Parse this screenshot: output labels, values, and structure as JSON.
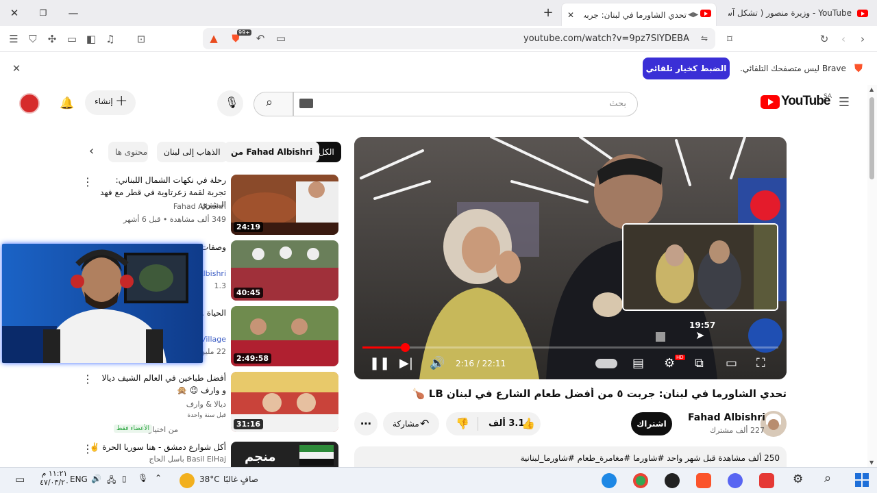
{
  "browser": {
    "tabs": [
      {
        "title": "YouTube - وزيرة منصور ( تشكل آس )",
        "active": false
      },
      {
        "title": "تحدي الشاورما في لبنان: جربت",
        "active": true
      }
    ],
    "url": "youtube.com/watch?v=9pz7SIYDEBA",
    "shields_badge": "99+"
  },
  "banner": {
    "text": "Brave ليس متصفحك التلقائي.",
    "button_label": "الضبط كخيار تلقائي"
  },
  "youtube": {
    "logo_text": "YouTube",
    "country_code": "SA",
    "search_placeholder": "بحث",
    "create_label": "إنشاء",
    "chips": [
      "الكل",
      "من Fahad Albishri",
      "الذهاب إلى لبنان",
      "محتوى ها"
    ],
    "player": {
      "current_time": "2:16",
      "duration": "22:11",
      "time_display": "2:16 / 22:11",
      "hover_time": "19:57",
      "progress_percent": 10.2,
      "hd_badge": "HD"
    },
    "video": {
      "title": "تحدي الشاورما في لبنان: جربت ٥ من أفضل طعام الشارع في لبنان LB 🍗",
      "channel": "Fahad Albishri",
      "subscribers": "227 ألف مشترك",
      "subscribe_label": "اشتراك",
      "likes": "3.1 ألف",
      "share_label": "مشاركة",
      "description_meta": "250 ألف مشاهدة  قبل شهر واحد  #شاورما #مغامرة_طعام #شاورما_لبنانية"
    },
    "recommendations": [
      {
        "title": "رحلة في نكهات الشمال اللبناني: تجربة لقمة زعرتاوية في قطر مع فهد البشري",
        "channel": "Fahad Albishri",
        "meta": "349 ألف مشاهدة • قبل 6 أشهر",
        "duration": "24:19"
      },
      {
        "title": "وصفات ... السعودي",
        "channel": "Albishri",
        "meta": "1.3",
        "duration": "40:45"
      },
      {
        "title": "الحياة ... فيديوات",
        "channel": "Village",
        "meta": "22 مليون",
        "duration": "2:49:58"
      },
      {
        "title": "أفضل طباخين في العالم  الشيف ديالا و وارف 😉 🙊",
        "channel": "ديالا & وارف",
        "meta": "قبل سنة واحدة",
        "extra": "من اختيار YouTube",
        "badge": "الأعضاء فقط",
        "duration": "31:16"
      },
      {
        "title": "أكل شوارع دمشق - هنا سوريا الحرة ✌️",
        "channel": "Basil ElHaj باسل الحاج",
        "meta": "",
        "duration": ""
      }
    ]
  },
  "taskbar": {
    "weather_temp": "38°C",
    "weather_text": "صافٍ غالبًا",
    "language": "ENG",
    "time": "١١:٢١ م",
    "date": "٤٧/٠٣/٢٠"
  },
  "colors": {
    "yt_red": "#ff0000",
    "brave_blue": "#3a2fd6",
    "player_progress": "#ff0000"
  }
}
